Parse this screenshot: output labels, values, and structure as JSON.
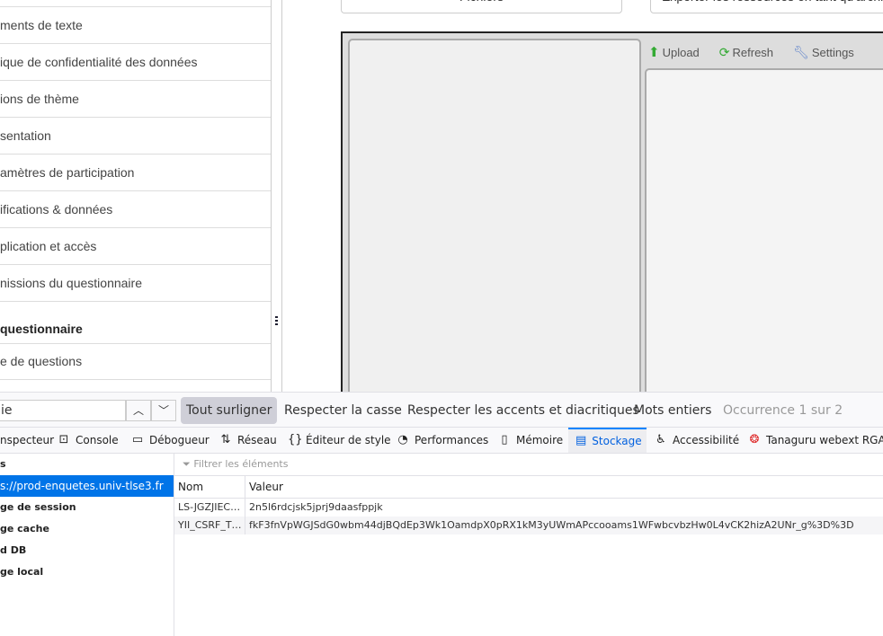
{
  "sidebar": {
    "items": [
      "ments de texte",
      "ique de confidentialité des données",
      "ions de thème",
      "sentation",
      "amètres de participation",
      "ifications & données",
      "plication et accès",
      "nissions du questionnaire"
    ],
    "section_header": "questionnaire",
    "section_items": [
      "e de questions"
    ]
  },
  "main": {
    "top_buttons": [
      "Fichiers",
      "Exporter les ressources en tant qu'archive"
    ],
    "toolbar": [
      {
        "label": "Upload",
        "icon": "upload-arrow-icon"
      },
      {
        "label": "Refresh",
        "icon": "refresh-icon"
      },
      {
        "label": "Settings",
        "icon": "wrench-icon"
      }
    ]
  },
  "findbar": {
    "query": "ie",
    "highlight_all": "Tout surligner",
    "match_case": "Respecter la casse",
    "match_diacritics": "Respecter les accents et diacritiques",
    "whole_words": "Mots entiers",
    "status": "Occurrence 1 sur 2"
  },
  "devtools": {
    "tabs": [
      {
        "label": "nspecteur"
      },
      {
        "label": "Console",
        "icon": ">"
      },
      {
        "label": "Débogueur",
        "icon": "▭"
      },
      {
        "label": "Réseau",
        "icon": "⇅"
      },
      {
        "label": "Éditeur de style",
        "icon": "{}"
      },
      {
        "label": "Performances",
        "icon": "◔"
      },
      {
        "label": "Mémoire",
        "icon": "▯"
      },
      {
        "label": "Stockage",
        "icon": "▤",
        "selected": true
      },
      {
        "label": "Accessibilité",
        "icon": "♿"
      },
      {
        "label": "Tanaguru webext RGAA",
        "icon": "◉"
      }
    ],
    "tree": [
      "s",
      "s://prod-enquetes.univ-tlse3.fr",
      "ge de session",
      "ge cache",
      "d DB",
      "ge local"
    ],
    "filter_placeholder": "Filtrer les éléments",
    "columns": [
      "Nom",
      "Valeur"
    ],
    "rows": [
      {
        "name": "LS-JGZJIEC…",
        "value": "2n5l6rdcjsk5jprj9daasfppjk"
      },
      {
        "name": "YII_CSRF_T…",
        "value": "fkF3fnVpWGJSdG0wbm44djBQdEp3Wk1OamdpX0pRX1kM3yUWmAPccooams1WFwbcvbzHw0L4vCK2hizA2UNr_g%3D%3D"
      }
    ]
  },
  "colors": {
    "accent": "#0a84ff",
    "selected": "#0074e8"
  }
}
